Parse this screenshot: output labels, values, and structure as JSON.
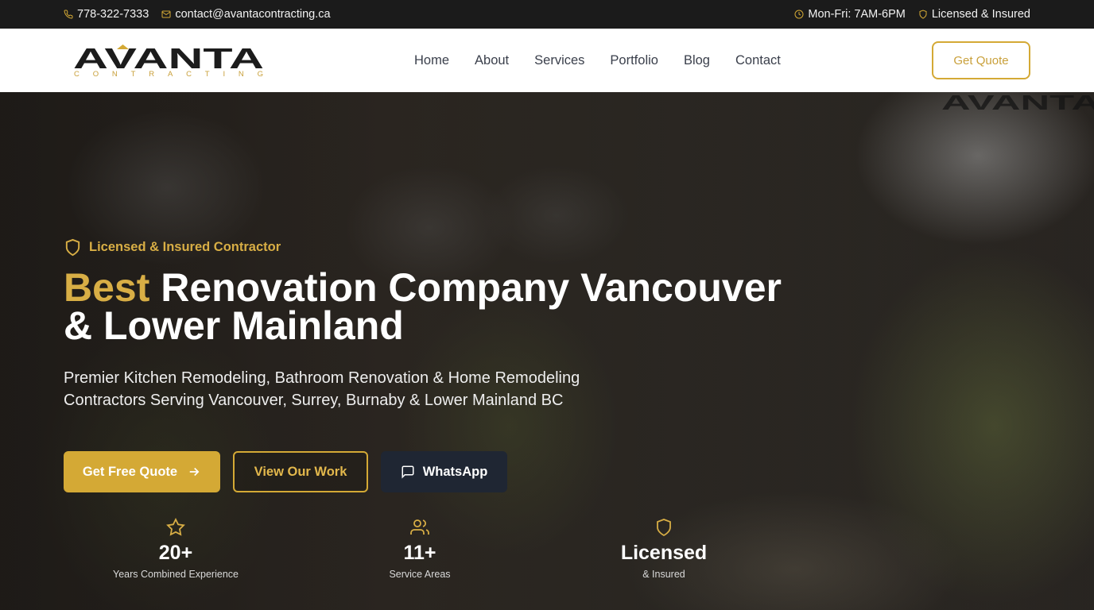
{
  "topbar": {
    "phone": "778-322-7333",
    "email": "contact@avantacontracting.ca",
    "hours": "Mon-Fri: 7AM-6PM",
    "license": "Licensed & Insured"
  },
  "header": {
    "logo_text": "AVANTA",
    "logo_subtext": "CONTRACTING",
    "nav": [
      "Home",
      "About",
      "Services",
      "Portfolio",
      "Blog",
      "Contact"
    ],
    "cta_label": "Get Quote"
  },
  "hero": {
    "badge": "Licensed & Insured Contractor",
    "title_accent": "Best",
    "title_rest": " Renovation Company Vancouver & Lower Mainland",
    "subtitle": "Premier Kitchen Remodeling, Bathroom Renovation & Home Remodeling Contractors Serving Vancouver, Surrey, Burnaby & Lower Mainland BC",
    "buttons": {
      "primary": "Get Free Quote",
      "secondary": "View Our Work",
      "whatsapp": "WhatsApp"
    },
    "stats": [
      {
        "icon": "star-icon",
        "value": "20+",
        "label": "Years Combined Experience"
      },
      {
        "icon": "users-icon",
        "value": "11+",
        "label": "Service Areas"
      },
      {
        "icon": "shield-icon",
        "value": "Licensed",
        "label": "& Insured"
      }
    ]
  },
  "colors": {
    "accent": "#d4a935",
    "topbar_bg": "#1b1b1b",
    "whatsapp_bg": "#1f2633"
  }
}
